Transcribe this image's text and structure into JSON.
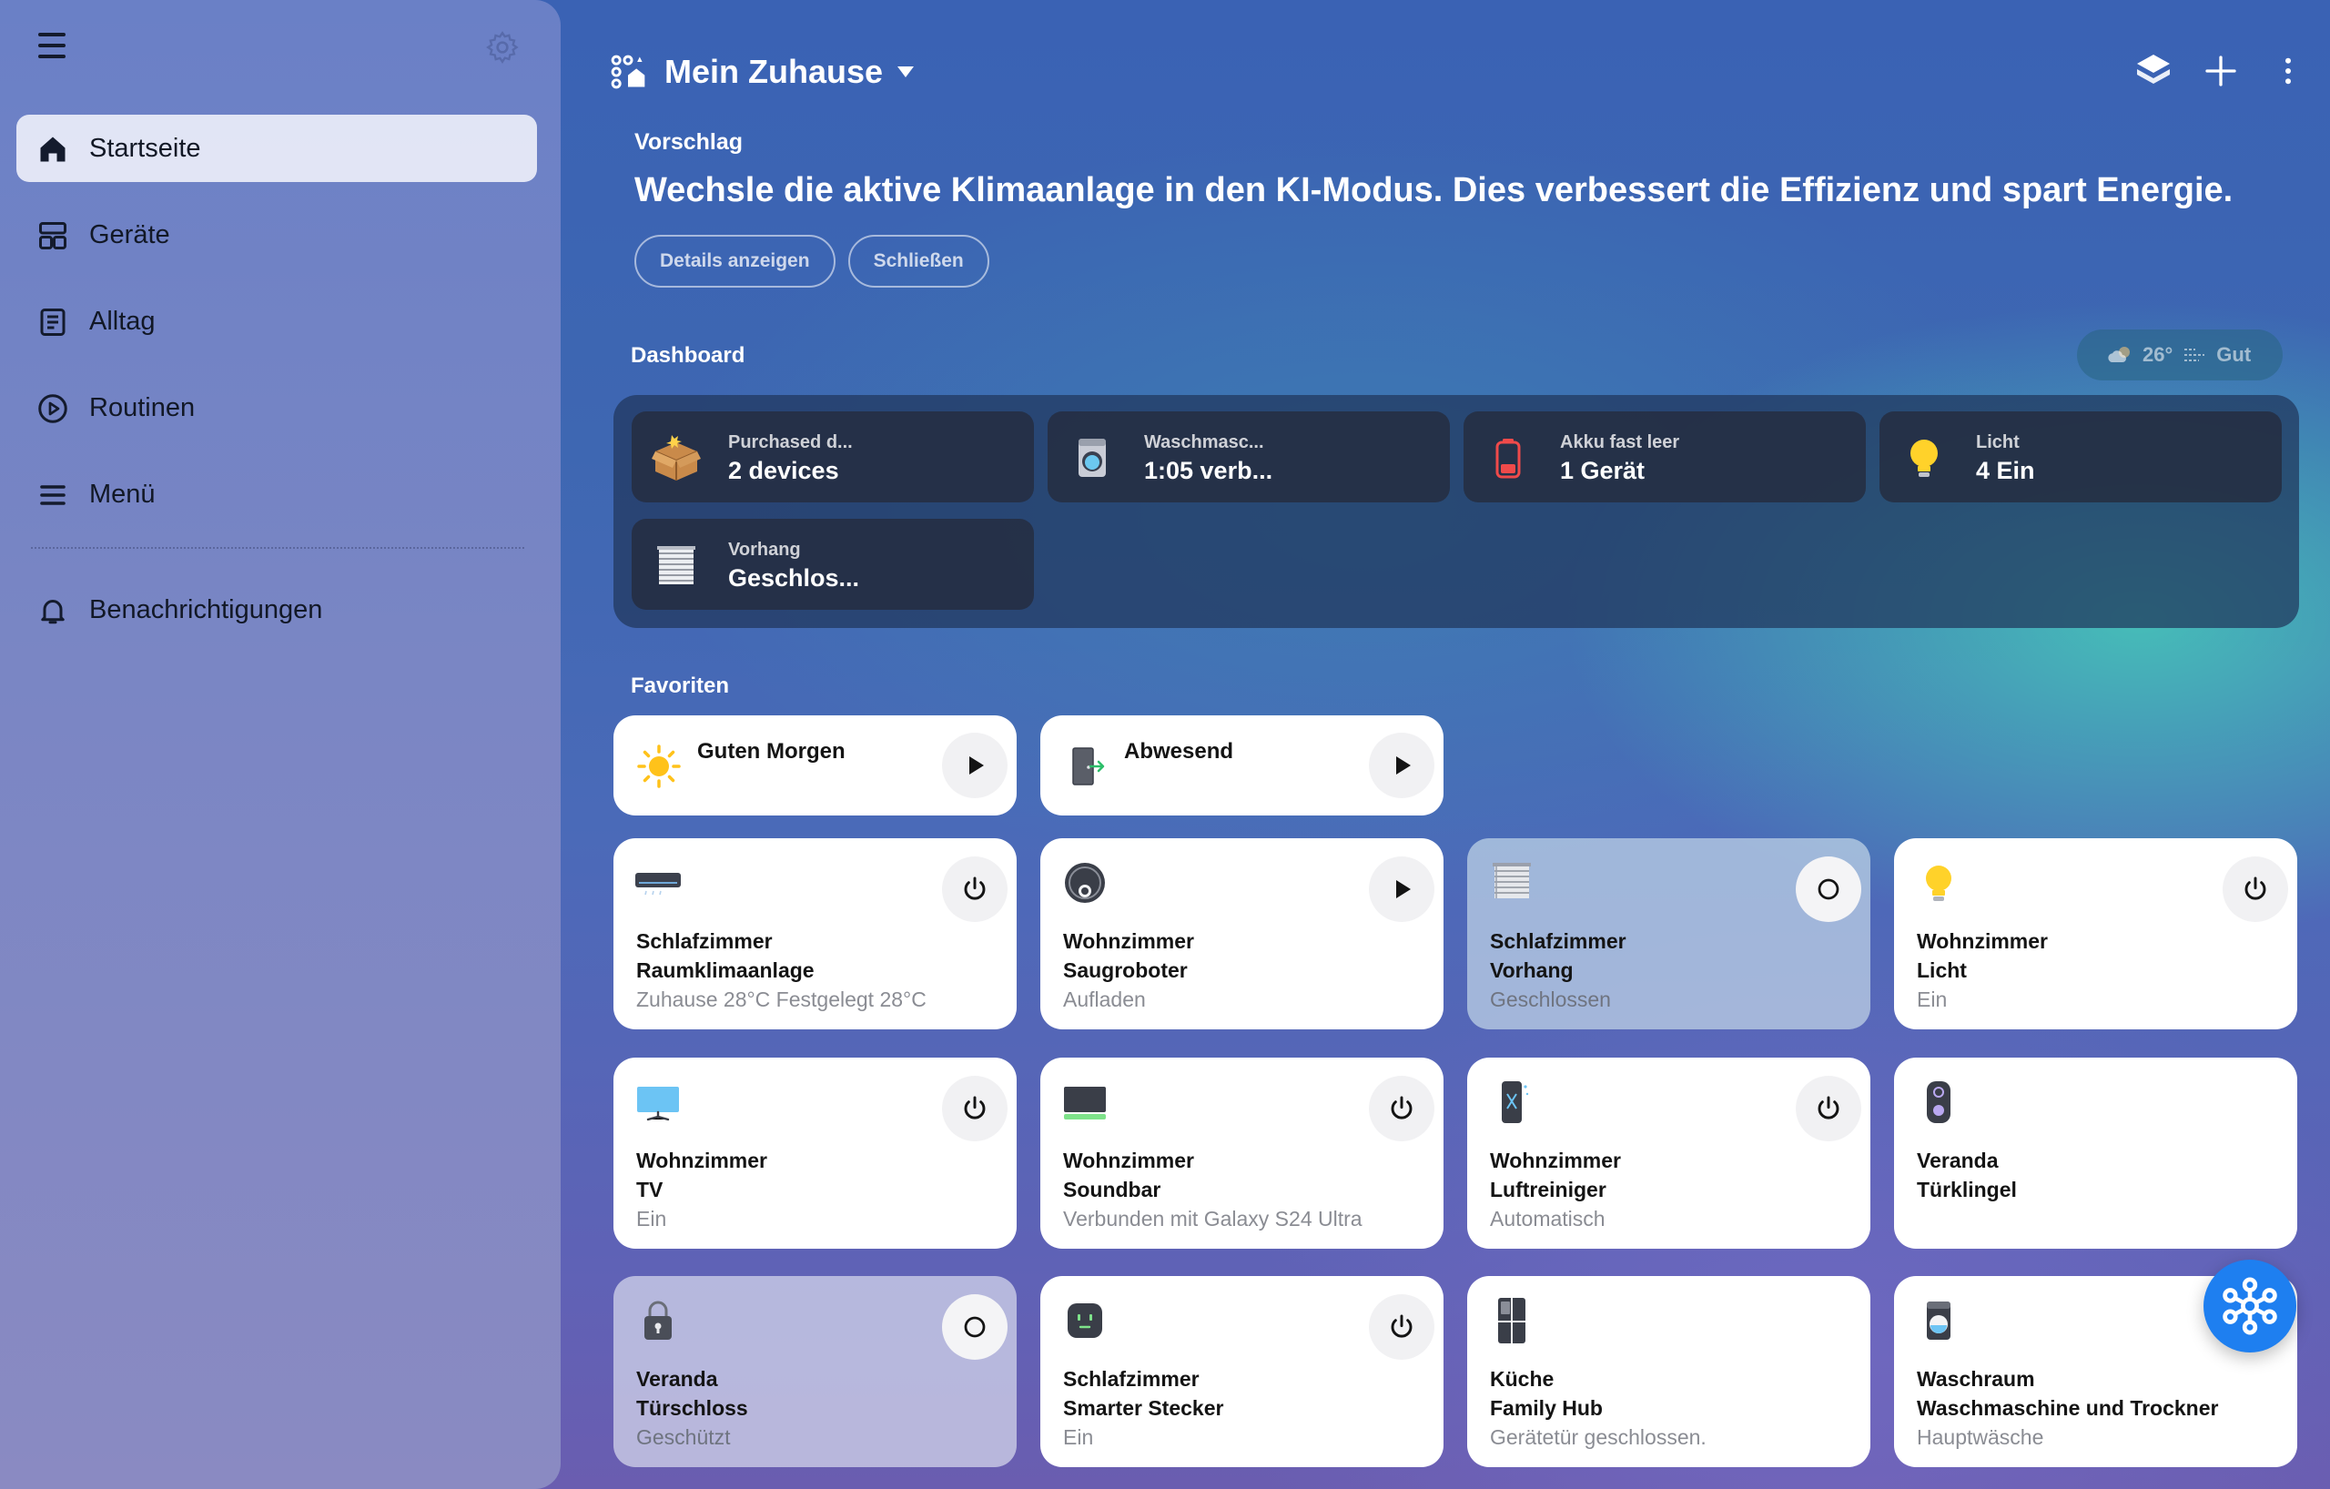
{
  "sidebar": {
    "items": [
      {
        "label": "Startseite",
        "icon": "home-icon",
        "active": true
      },
      {
        "label": "Geräte",
        "icon": "devices-icon"
      },
      {
        "label": "Alltag",
        "icon": "life-icon"
      },
      {
        "label": "Routinen",
        "icon": "routines-icon"
      },
      {
        "label": "Menü",
        "icon": "menu-icon"
      }
    ],
    "notifications_label": "Benachrichtigungen"
  },
  "header": {
    "title": "Mein Zuhause"
  },
  "suggestion": {
    "label": "Vorschlag",
    "text": "Wechsle die aktive Klimaanlage in den KI-Modus. Dies verbessert die Effizienz und spart Energie.",
    "details_label": "Details anzeigen",
    "close_label": "Schließen"
  },
  "dashboard": {
    "title": "Dashboard",
    "weather": {
      "temperature": "26°",
      "air_quality": "Gut"
    },
    "cards": [
      {
        "label": "Purchased d...",
        "value": "2 devices",
        "icon": "package-icon"
      },
      {
        "label": "Waschmasc...",
        "value": "1:05 verb...",
        "icon": "washer-icon"
      },
      {
        "label": "Akku fast leer",
        "value": "1 Gerät",
        "icon": "battery-low-icon"
      },
      {
        "label": "Licht",
        "value": "4 Ein",
        "icon": "bulb-icon"
      },
      {
        "label": "Vorhang",
        "value": "Geschlos...",
        "icon": "blind-icon"
      }
    ]
  },
  "favorites": {
    "title": "Favoriten",
    "routines": [
      {
        "name": "Guten Morgen",
        "icon": "sun-icon"
      },
      {
        "name": "Abwesend",
        "icon": "door-exit-icon"
      }
    ],
    "devices": [
      {
        "room": "Schlafzimmer",
        "name": "Raumklimaanlage",
        "status": "Zuhause 28°C Festgelegt 28°C",
        "icon": "air-conditioner-icon",
        "action": "power"
      },
      {
        "room": "Wohnzimmer",
        "name": "Saugroboter",
        "status": "Aufladen",
        "icon": "robot-vacuum-icon",
        "action": "play"
      },
      {
        "room": "Schlafzimmer",
        "name": "Vorhang",
        "status": "Geschlossen",
        "icon": "blind-icon",
        "action": "circle"
      },
      {
        "room": "Wohnzimmer",
        "name": "Licht",
        "status": "Ein",
        "icon": "bulb-icon",
        "action": "power"
      },
      {
        "room": "Wohnzimmer",
        "name": "TV",
        "status": "Ein",
        "icon": "tv-icon",
        "action": "power"
      },
      {
        "room": "Wohnzimmer",
        "name": "Soundbar",
        "status": "Verbunden mit Galaxy S24 Ultra",
        "icon": "soundbar-icon",
        "action": "power"
      },
      {
        "room": "Wohnzimmer",
        "name": "Luftreiniger",
        "status": "Automatisch",
        "icon": "air-purifier-icon",
        "action": "power"
      },
      {
        "room": "Veranda",
        "name": "Türklingel",
        "status": "",
        "icon": "doorbell-icon",
        "action": "none"
      },
      {
        "room": "Veranda",
        "name": "Türschloss",
        "status": "Geschützt",
        "icon": "lock-icon",
        "action": "circle"
      },
      {
        "room": "Schlafzimmer",
        "name": "Smarter Stecker",
        "status": "Ein",
        "icon": "smart-plug-icon",
        "action": "power"
      },
      {
        "room": "Küche",
        "name": "Family Hub",
        "status": "Gerätetür geschlossen.",
        "icon": "fridge-icon",
        "action": "none"
      },
      {
        "room": "Waschraum",
        "name": "Waschmaschine und Trockner",
        "status": "Hauptwäsche",
        "icon": "washer-icon",
        "action": "none"
      }
    ]
  },
  "colors": {
    "accent": "#1e7ff0",
    "sidebar_active": "#eceef8",
    "card": "#ffffff",
    "status_text": "#8a8c93"
  }
}
